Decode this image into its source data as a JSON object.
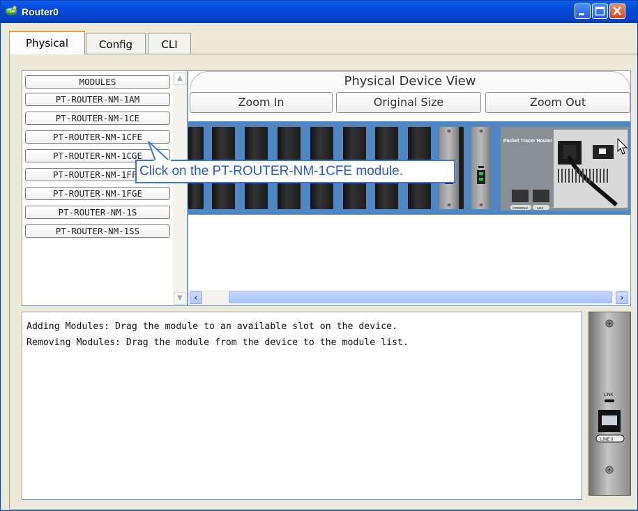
{
  "window": {
    "title": "Router0"
  },
  "tabs": [
    {
      "label": "Physical",
      "active": true
    },
    {
      "label": "Config",
      "active": false
    },
    {
      "label": "CLI",
      "active": false
    }
  ],
  "modules": {
    "header": "MODULES",
    "items": [
      "PT-ROUTER-NM-1AM",
      "PT-ROUTER-NM-1CE",
      "PT-ROUTER-NM-1CFE",
      "PT-ROUTER-NM-1CGE",
      "PT-ROUTER-NM-1FFE",
      "PT-ROUTER-NM-1FGE",
      "PT-ROUTER-NM-1S",
      "PT-ROUTER-NM-1SS"
    ]
  },
  "device_view": {
    "title": "Physical Device View",
    "zoom_in": "Zoom In",
    "original_size": "Original Size",
    "zoom_out": "Zoom Out",
    "router_label": "Packet Tracer Router",
    "port_console": "CONSOLE",
    "port_aux": "AUX"
  },
  "tooltip": "Click on the PT-ROUTER-NM-1CFE module.",
  "info": {
    "line1": "Adding Modules: Drag the module to an available slot on the device.",
    "line2": "Removing Modules: Drag the module from the device to the module list."
  },
  "module_preview": {
    "link_label": "LINK",
    "port_label": "LINE 0"
  },
  "colors": {
    "titlebar": "#0548d6",
    "tooltip_text": "#2b59d9",
    "router_chassis": "#4f87c4"
  },
  "icons": [
    "router-app-icon",
    "minimize-icon",
    "maximize-icon",
    "close-icon",
    "scroll-up-icon",
    "scroll-down-icon",
    "scroll-left-icon",
    "scroll-right-icon",
    "mouse-pointer-icon"
  ]
}
